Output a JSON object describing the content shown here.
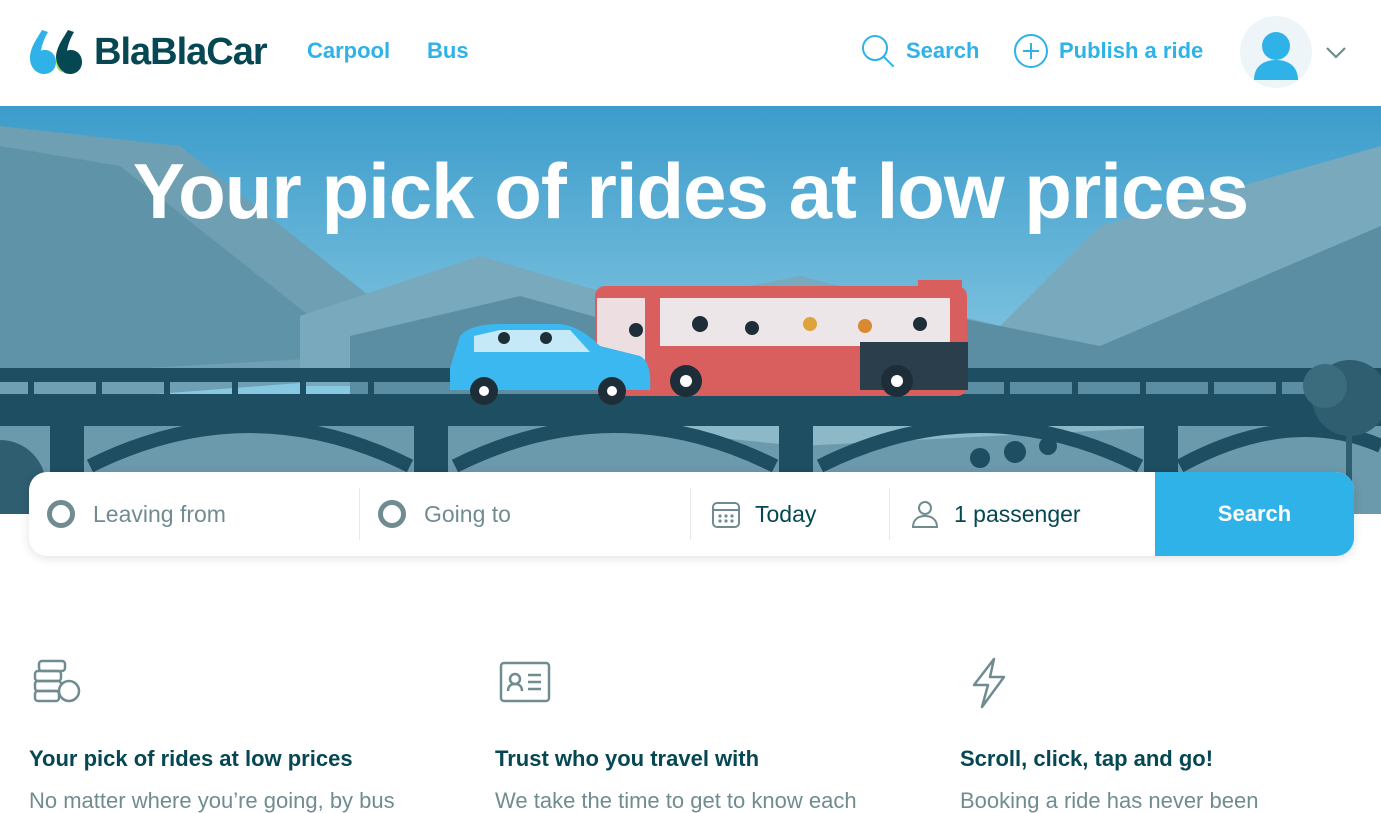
{
  "header": {
    "logo_text": "BlaBlaCar",
    "nav": [
      {
        "label": "Carpool"
      },
      {
        "label": "Bus"
      }
    ],
    "search_label": "Search",
    "publish_label": "Publish a ride"
  },
  "hero": {
    "title": "Your pick of rides at low prices"
  },
  "searchbar": {
    "from_placeholder": "Leaving from",
    "to_placeholder": "Going to",
    "date_value": "Today",
    "passengers_value": "1 passenger",
    "button_label": "Search"
  },
  "features": [
    {
      "icon": "coins-icon",
      "title": "Your pick of rides at low prices",
      "text": "No matter where you’re going, by bus"
    },
    {
      "icon": "id-card-icon",
      "title": "Trust who you travel with",
      "text": "We take the time to get to know each"
    },
    {
      "icon": "lightning-icon",
      "title": "Scroll, click, tap and go!",
      "text": "Booking a ride has never been"
    }
  ],
  "colors": {
    "brand_blue": "#2eb2e8",
    "dark_teal": "#054752",
    "muted": "#708c91"
  }
}
